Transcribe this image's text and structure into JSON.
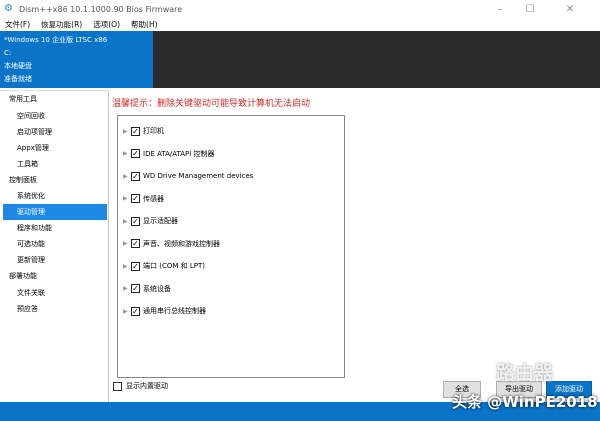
{
  "window": {
    "title": "Dism++x86 10.1.1000.90 Bios Firmware",
    "minimize": "–",
    "maximize": "☐",
    "close": "✕"
  },
  "menu": [
    "文件(F)",
    "恢复功能(R)",
    "选项(O)",
    "帮助(H)"
  ],
  "image_info": {
    "name": "*Windows 10 企业版 LTSC x86",
    "drive": "C:",
    "type": "本地硬盘",
    "status": "准备就绪"
  },
  "sidebar": [
    {
      "kind": "group",
      "label": "常用工具"
    },
    {
      "kind": "item",
      "label": "空间回收"
    },
    {
      "kind": "item",
      "label": "启动项管理"
    },
    {
      "kind": "item",
      "label": "Appx管理"
    },
    {
      "kind": "item",
      "label": "工具箱"
    },
    {
      "kind": "group",
      "label": "控制面板"
    },
    {
      "kind": "item",
      "label": "系统优化"
    },
    {
      "kind": "item",
      "label": "驱动管理",
      "active": true
    },
    {
      "kind": "item",
      "label": "程序和功能"
    },
    {
      "kind": "item",
      "label": "可选功能"
    },
    {
      "kind": "item",
      "label": "更新管理"
    },
    {
      "kind": "group",
      "label": "部署功能"
    },
    {
      "kind": "item",
      "label": "文件关联"
    },
    {
      "kind": "item",
      "label": "预应答"
    }
  ],
  "main": {
    "warning": "温馨提示：删除关键驱动可能导致计算机无法启动",
    "drivers": [
      {
        "label": "打印机",
        "checked": true
      },
      {
        "label": "IDE ATA/ATAPI 控制器",
        "checked": true
      },
      {
        "label": "WD Drive Management devices",
        "checked": true
      },
      {
        "label": "传感器",
        "checked": true
      },
      {
        "label": "显示适配器",
        "checked": true
      },
      {
        "label": "声音、视频和游戏控制器",
        "checked": true
      },
      {
        "label": "端口 (COM 和 LPT)",
        "checked": true
      },
      {
        "label": "系统设备",
        "checked": true
      },
      {
        "label": "通用串行总线控制器",
        "checked": true
      }
    ],
    "show_builtin": "显示内置驱动",
    "buttons": {
      "select_all": "全选",
      "export": "导出驱动",
      "add": "添加驱动"
    }
  },
  "watermark": {
    "brand": "路由器",
    "credit": "头条 @WinPE2018"
  },
  "colors": {
    "accent": "#0a74c9",
    "warning": "#d12b2b",
    "header_dark": "#2b2b2b"
  }
}
